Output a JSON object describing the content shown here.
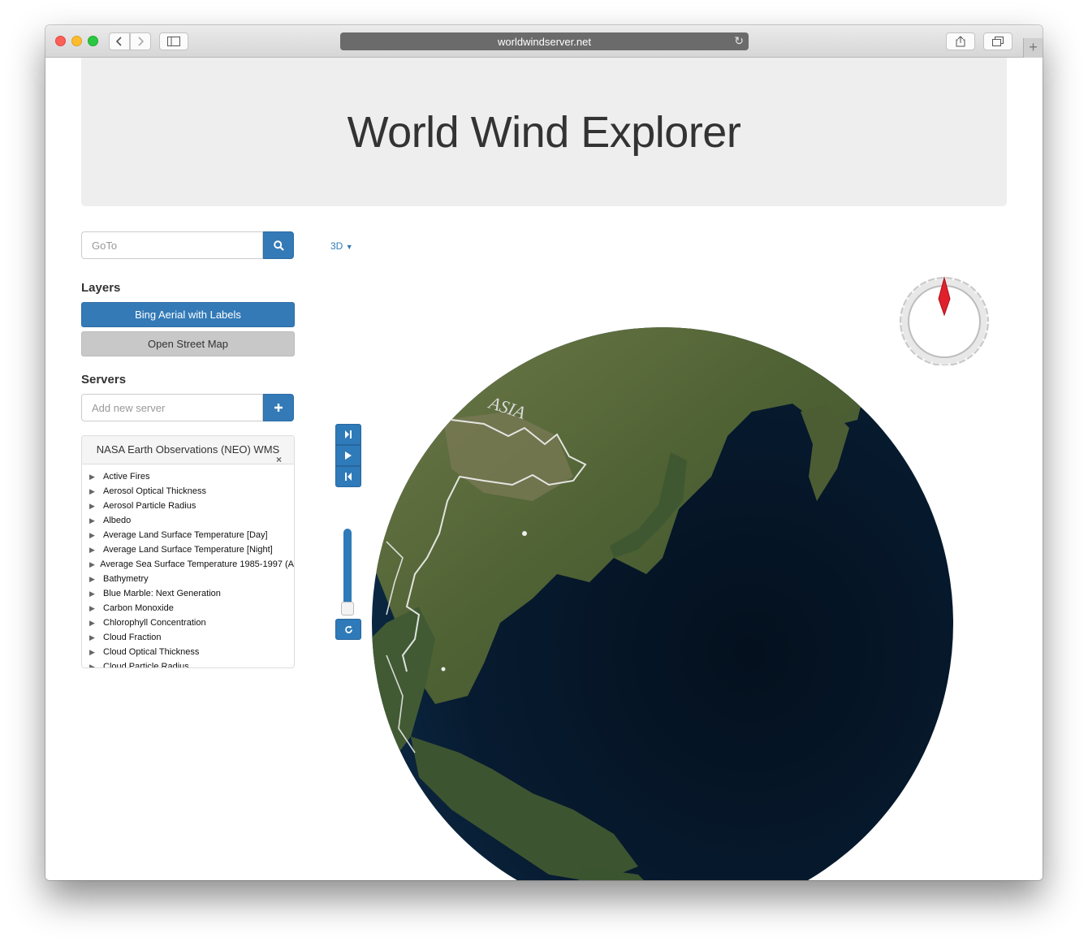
{
  "browser": {
    "url": "worldwindserver.net"
  },
  "header": {
    "title": "World Wind Explorer"
  },
  "goto": {
    "placeholder": "GoTo"
  },
  "layers": {
    "heading": "Layers",
    "items": [
      {
        "label": "Bing Aerial with Labels",
        "active": true
      },
      {
        "label": "Open Street Map",
        "active": false
      }
    ]
  },
  "servers": {
    "heading": "Servers",
    "add_placeholder": "Add new server",
    "panel_title": "NASA Earth Observations (NEO) WMS",
    "close_glyph": "×",
    "items": [
      "Active Fires",
      "Aerosol Optical Thickness",
      "Aerosol Particle Radius",
      "Albedo",
      "Average Land Surface Temperature [Day]",
      "Average Land Surface Temperature [Night]",
      "Average Sea Surface Temperature 1985-1997 (A",
      "Bathymetry",
      "Blue Marble: Next Generation",
      "Carbon Monoxide",
      "Chlorophyll Concentration",
      "Cloud Fraction",
      "Cloud Optical Thickness",
      "Cloud Particle Radius"
    ]
  },
  "view": {
    "projection": "3D"
  },
  "globe": {
    "label": "ASIA"
  },
  "colors": {
    "primary": "#337ab7",
    "ocean": "#071b30",
    "land": "#5a6b3a",
    "compass_needle": "#e0202a"
  }
}
